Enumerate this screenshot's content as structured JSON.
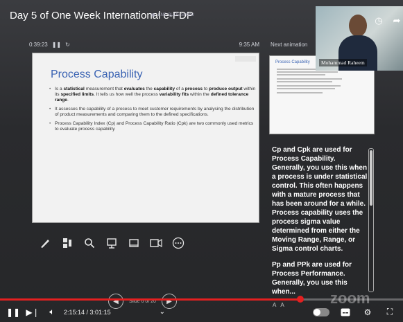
{
  "video": {
    "title": "Day 5 of One Week International e-FDP",
    "end_slideshow": "END SLIDE SHOW"
  },
  "presenter": {
    "elapsed": "0:39:23",
    "clock": "9:35 AM",
    "next_label": "Next animation"
  },
  "slide": {
    "title": "Process Capability",
    "bullets": [
      "Is a statistical measurement that evaluates the capability of a process to produce output within its specified limits. It tells us how well the process variability fits within the defined tolerance range.",
      "It assesses the capability of a process to meet customer requirements by analysing the distribution of product measurements and comparing them to the defined specifications.",
      "Process Capability Index (Cp) and Process Capability Ratio (Cpk) are two commonly used metrics to evaluate process capability"
    ]
  },
  "next_thumb": {
    "title": "Process Capability"
  },
  "notes": {
    "p1": "Cp and Cpk are used for Process Capability. Generally, you use this when a process is under statistical control. This often happens with a mature process that has been around for a while. Process capability uses the process sigma value determined from either the Moving Range, Range, or Sigma control charts.",
    "p2": "Pp and PPk are used for Process Performance. Generally, you use this when..."
  },
  "webcam": {
    "name": "Mohammad Raheem"
  },
  "slide_nav": {
    "label": "Slide 6 of 20"
  },
  "player": {
    "current_time": "2:15:14",
    "duration": "3:01:15",
    "time_sep": " / ",
    "progress": 0.746
  },
  "watermark": "zoom",
  "colors": {
    "accent": "#e32020",
    "slide_title": "#3a63b3"
  }
}
